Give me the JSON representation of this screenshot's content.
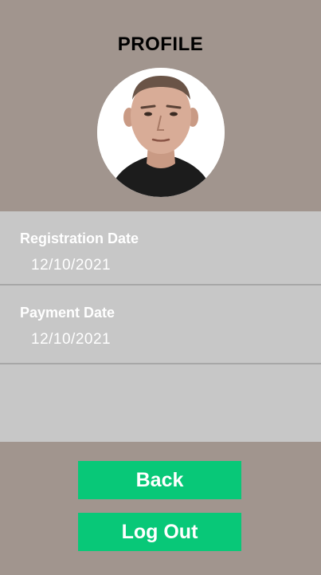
{
  "page": {
    "title": "PROFILE"
  },
  "profile": {
    "avatar_icon": "user-photo",
    "fields": [
      {
        "label": "Registration Date",
        "value": "12/10/2021"
      },
      {
        "label": "Payment Date",
        "value": "12/10/2021"
      }
    ]
  },
  "actions": {
    "back_label": "Back",
    "logout_label": "Log Out"
  },
  "colors": {
    "background": "#a1958e",
    "panel": "#c7c7c7",
    "button": "#08c878",
    "text_light": "#ffffff"
  }
}
